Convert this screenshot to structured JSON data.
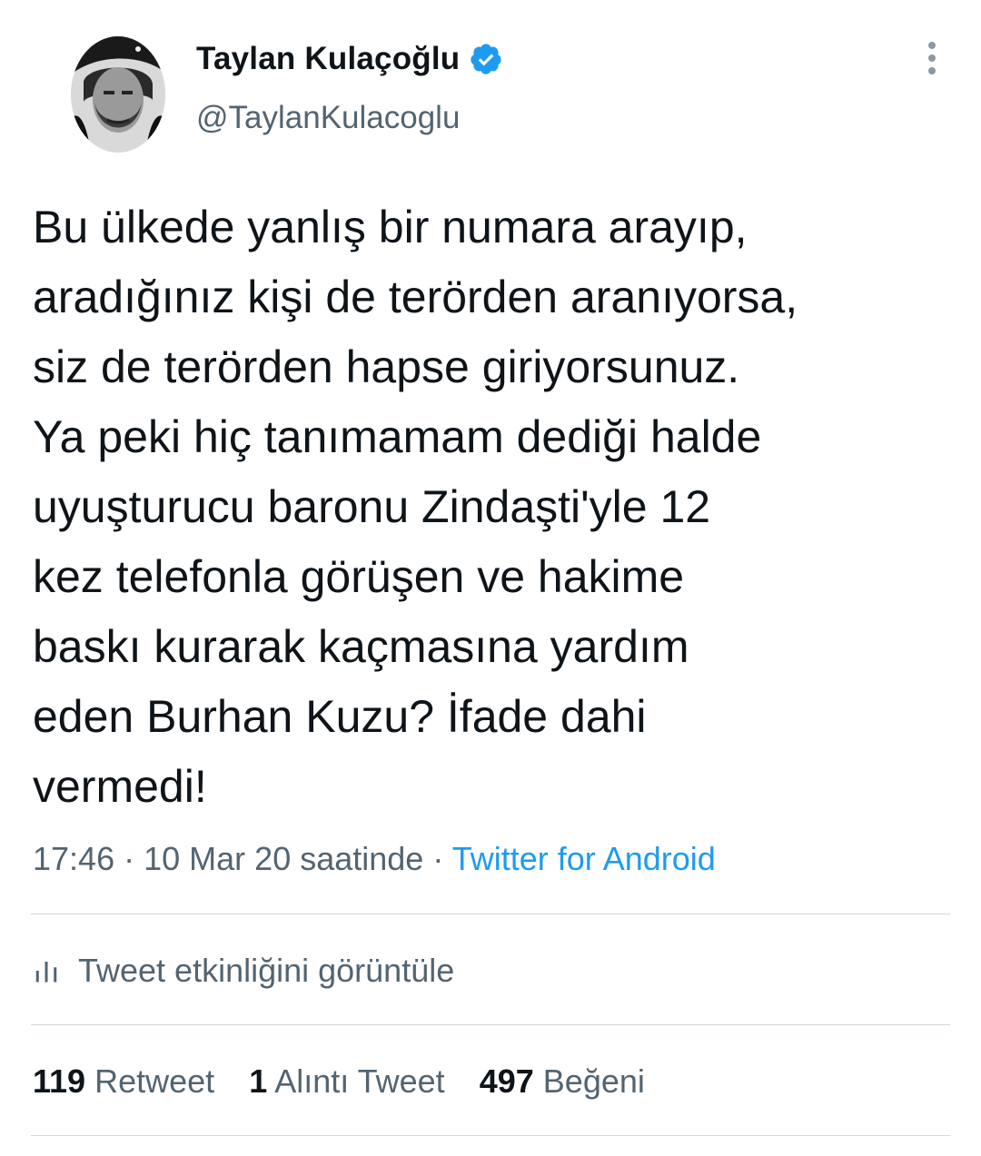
{
  "author": {
    "display_name": "Taylan Kulaçoğlu",
    "handle": "@TaylanKulacoglu",
    "verified": true,
    "avatar_icon": "profile-photo"
  },
  "tweet": {
    "text": "Bu ülkede yanlış bir numara arayıp,\naradığınız kişi de terörden aranıyorsa,\nsiz de terörden hapse giriyorsunuz.\nYa peki hiç tanımamam dediği halde\nuyuşturucu baronu Zindaşti'yle 12\nkez telefonla görüşen ve hakime\nbaskı kurarak kaçmasına yardım\neden Burhan Kuzu? İfade dahi\nvermedi!",
    "time": "17:46",
    "date": "10 Mar 20 saatinde",
    "separator": "·",
    "source": "Twitter for Android"
  },
  "activity": {
    "label": "Tweet etkinliğini görüntüle",
    "icon": "analytics-bar-icon"
  },
  "stats": {
    "retweets_count": "119",
    "retweets_label": "Retweet",
    "quotes_count": "1",
    "quotes_label": "Alıntı Tweet",
    "likes_count": "497",
    "likes_label": "Beğeni"
  },
  "colors": {
    "text_primary": "#0f1419",
    "text_secondary": "#536471",
    "accent": "#1d9bf0",
    "divider": "#cfd9de"
  }
}
